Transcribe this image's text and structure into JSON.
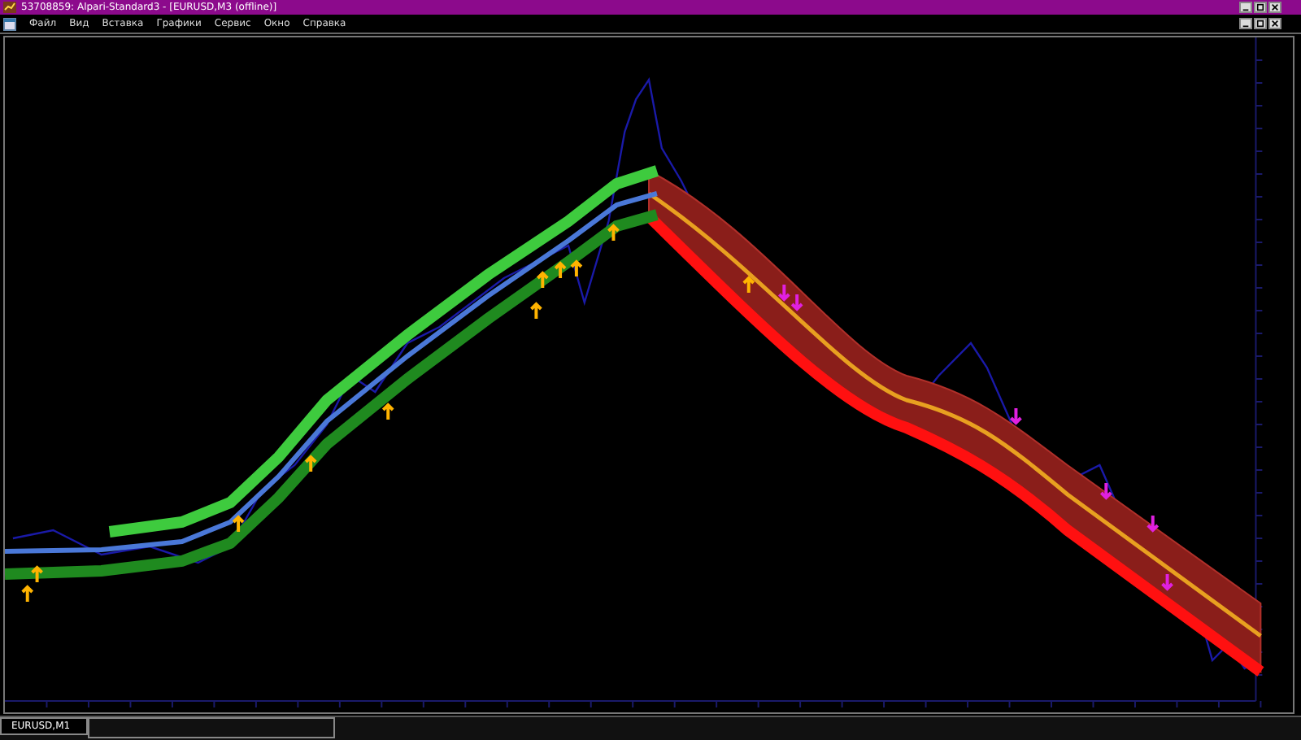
{
  "window": {
    "title": "53708859: Alpari-Standard3 - [EURUSD,M3 (offline)]"
  },
  "menu": [
    "Файл",
    "Вид",
    "Вставка",
    "Графики",
    "Сервис",
    "Окно",
    "Справка"
  ],
  "chart_tabs": [
    {
      "label": "EURUSD,M1",
      "selected": true
    }
  ]
}
